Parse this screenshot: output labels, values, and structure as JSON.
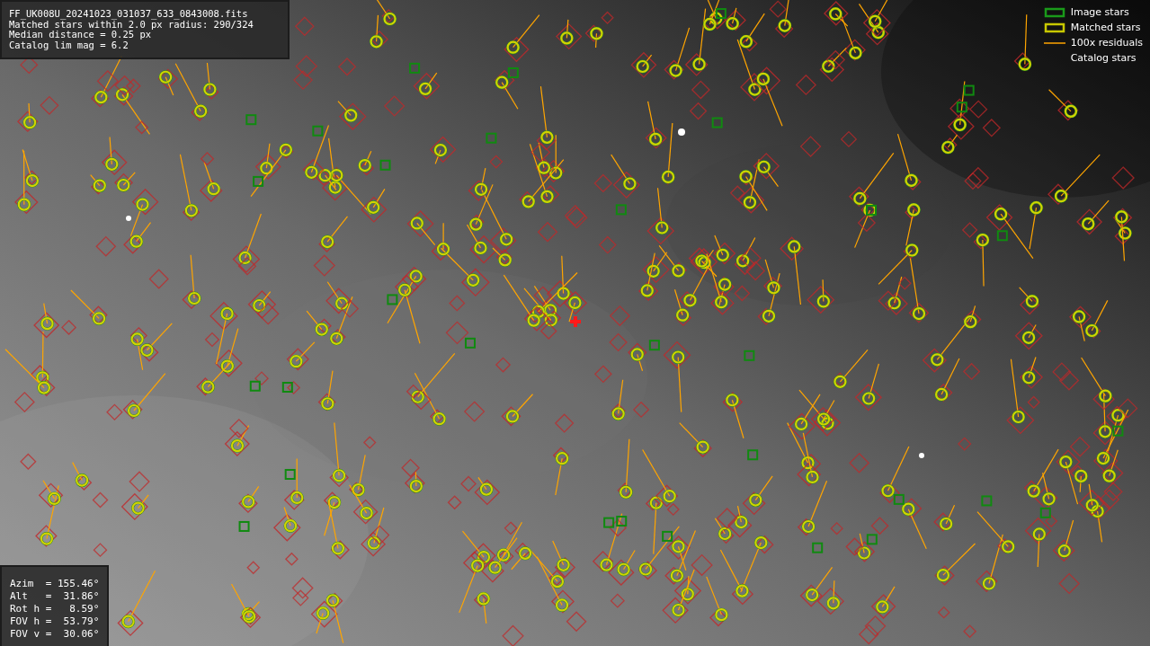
{
  "info_panel": {
    "lines": [
      "FF_UK008U_20241023_031037_633_0843008.fits",
      "Matched stars within 2.0 px radius: 290/324",
      "Median distance = 0.25 px",
      "Catalog lim mag = 6.2"
    ]
  },
  "pointing_panel": {
    "lines": [
      "Azim  = 155.46°",
      "Alt   =  31.86°",
      "Rot h =   8.59°",
      "FOV h =  53.79°",
      "FOV v =  30.06°"
    ]
  },
  "legend": {
    "items": [
      {
        "kind": "image_stars",
        "label": "Image stars"
      },
      {
        "kind": "matched_stars",
        "label": "Matched stars"
      },
      {
        "kind": "residuals",
        "label": "100x residuals"
      },
      {
        "kind": "catalog_stars",
        "label": "Catalog stars"
      }
    ]
  }
}
